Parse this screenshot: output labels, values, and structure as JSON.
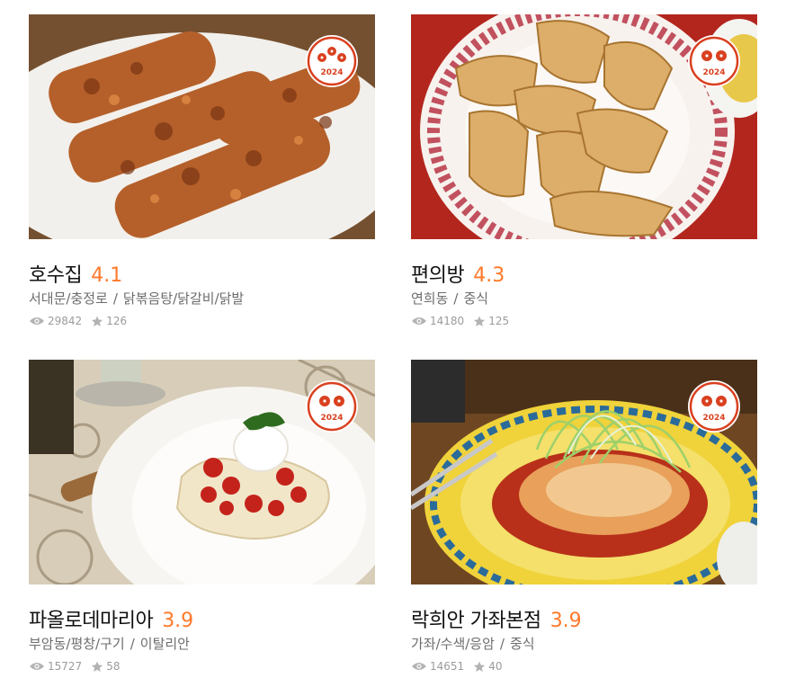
{
  "restaurants": [
    {
      "name": "호수집",
      "rating": "4.1",
      "area": "서대문/충정로",
      "category": "닭볶음탕/닭갈비/닭발",
      "views": "29842",
      "reviews": "126",
      "badge_year": "2024",
      "badge_icon": "flower-stars-icon"
    },
    {
      "name": "편의방",
      "rating": "4.3",
      "area": "연희동",
      "category": "중식",
      "views": "14180",
      "reviews": "125",
      "badge_year": "2024",
      "badge_icon": "flower-stars-icon"
    },
    {
      "name": "파올로데마리아",
      "rating": "3.9",
      "area": "부암동/평창/구기",
      "category": "이탈리안",
      "views": "15727",
      "reviews": "58",
      "badge_year": "2024",
      "badge_icon": "flower-stars-icon"
    },
    {
      "name": "락희안 가좌본점",
      "rating": "3.9",
      "area": "가좌/수색/응암",
      "category": "중식",
      "views": "14651",
      "reviews": "40",
      "badge_year": "2024",
      "badge_icon": "flower-stars-icon"
    }
  ],
  "separator": "/",
  "colors": {
    "rating": "#ff792a",
    "badge": "#d9401f",
    "meta": "#6d6d6d",
    "stats": "#9b9b9b"
  }
}
